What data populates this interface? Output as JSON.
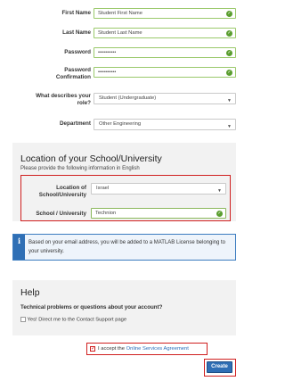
{
  "form": {
    "first_name_label": "First Name",
    "first_name_value": "Student First Name",
    "last_name_label": "Last Name",
    "last_name_value": "Student Last Name",
    "password_label": "Password",
    "password_value": "••••••••••",
    "password_confirm_label_1": "Password",
    "password_confirm_label_2": "Confirmation",
    "password_confirm_value": "••••••••••",
    "role_label_1": "What describes your",
    "role_label_2": "role?",
    "role_value": "Student (Undergraduate)",
    "department_label": "Department",
    "department_value": "Other Engineering"
  },
  "school": {
    "title": "Location of your School/University",
    "subtitle": "Please provide the following information in English",
    "location_label_1": "Location of",
    "location_label_2": "School/University",
    "location_value": "Israel",
    "name_label": "School / University",
    "name_value": "Technion"
  },
  "info": {
    "icon": "i",
    "text": "Based on your email address, you will be added to a MATLAB License belonging to your university."
  },
  "help": {
    "title": "Help",
    "question": "Technical problems or questions about your account?",
    "option": "Yes! Direct me to the Contact Support page"
  },
  "agree": {
    "prefix": "I accept the ",
    "link": "Online Services Agreement"
  },
  "create_label": "Create",
  "colors": {
    "valid_border": "#9ac96b",
    "check_green": "#5a9e2f",
    "highlight_red": "#d01f1f",
    "primary_blue": "#2f6fb5",
    "link_blue": "#2a6ebb"
  }
}
